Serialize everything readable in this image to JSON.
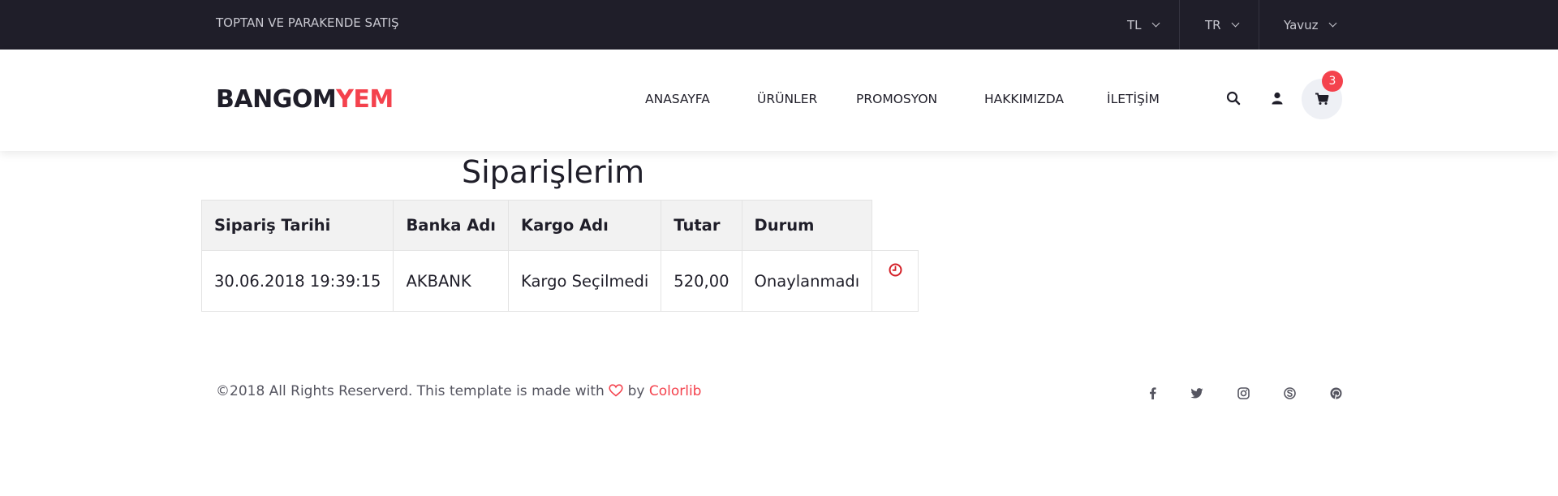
{
  "topbar": {
    "tagline": "TOPTAN VE PARAKENDE SATIŞ",
    "currency": "TL",
    "language": "TR",
    "user": "Yavuz"
  },
  "header": {
    "logo_part1": "BANGOM",
    "logo_part2": "YEM",
    "nav": [
      "ANASAYFA",
      "ÜRÜNLER",
      "PROMOSYON",
      "HAKKIMIZDA",
      "İLETİŞİM"
    ],
    "cart_count": "3"
  },
  "page_title": "Siparişlerim",
  "orders_table": {
    "columns": [
      "Sipariş Tarihi",
      "Banka Adı",
      "Kargo Adı",
      "Tutar",
      "Durum"
    ],
    "rows": [
      [
        "30.06.2018 19:39:15",
        "AKBANK",
        "Kargo Seçilmedi",
        "520,00",
        "Onaylanmadı"
      ]
    ]
  },
  "footer": {
    "text_before": "©2018 All Rights Reserverd. This template is made with",
    "text_by": "by",
    "link": "Colorlib",
    "social_icons": [
      "facebook-icon",
      "twitter-icon",
      "instagram-icon",
      "skype-icon",
      "pinterest-icon"
    ]
  },
  "colors": {
    "accent": "#f4424d",
    "topbar_bg": "#1f1e29",
    "text_dark": "#1f1e29"
  }
}
